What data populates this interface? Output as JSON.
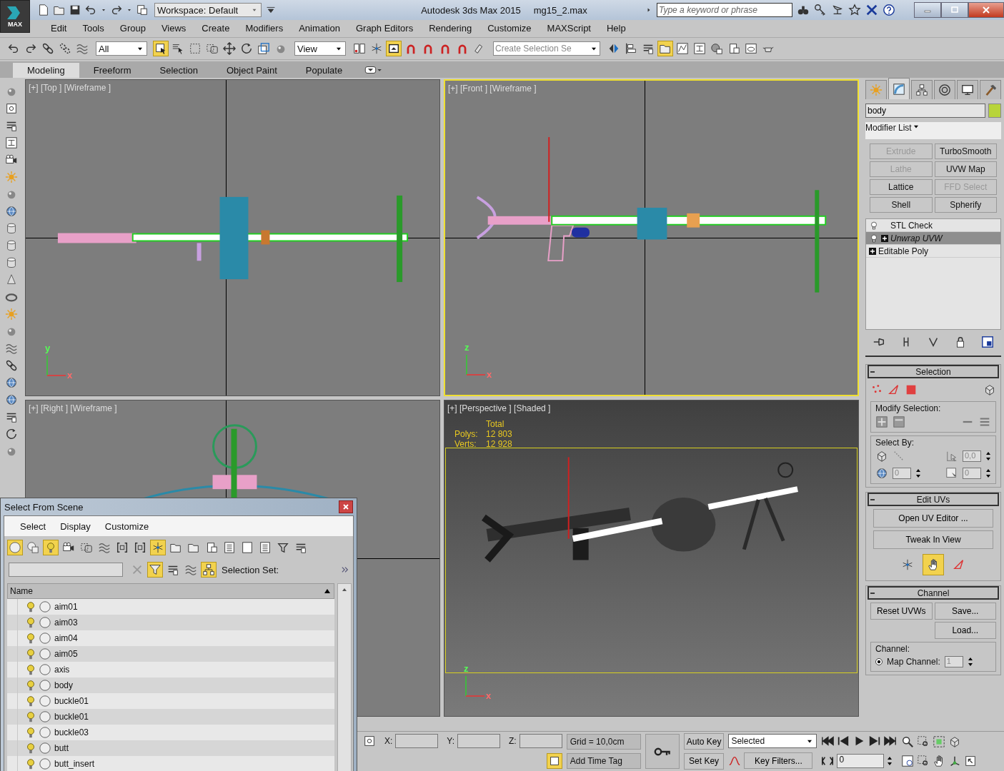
{
  "title_bar": {
    "app_label": "MAX",
    "workspace": "Workspace: Default",
    "title": "Autodesk 3ds Max  2015",
    "file": "mg15_2.max",
    "search": {
      "placeholder": "Type a keyword or phrase"
    }
  },
  "menu_bar": [
    "Edit",
    "Tools",
    "Group",
    "Views",
    "Create",
    "Modifiers",
    "Animation",
    "Graph Editors",
    "Rendering",
    "Customize",
    "MAXScript",
    "Help"
  ],
  "main_toolbar": {
    "left_buttons": [
      {
        "on": false
      },
      {
        "on": false
      },
      {
        "on": false
      },
      {
        "on": false
      },
      {
        "on": false
      }
    ],
    "selection_filter": "All",
    "select_buttons": [
      {
        "on": true
      },
      {
        "on": false
      },
      {
        "on": false
      },
      {
        "on": false
      },
      {
        "on": false
      },
      {
        "on": false
      },
      {
        "on": false
      },
      {
        "on": false
      }
    ],
    "reference_coordinate": "View",
    "snap_buttons": [
      {
        "on": false
      },
      {
        "on": false
      },
      {
        "on": true
      },
      {
        "on": false
      },
      {
        "on": false
      },
      {
        "on": false
      },
      {
        "on": false
      },
      {
        "on": false
      }
    ],
    "named_selection": {
      "placeholder": "Create Selection Se"
    },
    "scene_buttons": [
      {
        "on": false
      },
      {
        "on": false
      },
      {
        "on": false
      },
      {
        "on": true
      },
      {
        "on": false
      },
      {
        "on": false
      },
      {
        "on": false
      },
      {
        "on": false
      },
      {
        "on": false
      },
      {
        "on": false
      }
    ]
  },
  "ribbon_tabs": [
    {
      "label": "Modeling",
      "selected": true
    },
    {
      "label": "Freeform",
      "selected": false
    },
    {
      "label": "Selection",
      "selected": false
    },
    {
      "label": "Object Paint",
      "selected": false
    },
    {
      "label": "Populate",
      "selected": false
    }
  ],
  "viewports": [
    {
      "kind": "top",
      "label": "[+] [Top ] [Wireframe ]",
      "active": false,
      "axes": [
        "y",
        "x"
      ]
    },
    {
      "kind": "front",
      "label": "[+] [Front ] [Wireframe ]",
      "active": true,
      "axes": [
        "z",
        "x"
      ]
    },
    {
      "kind": "right",
      "label": "[+] [Right ] [Wireframe ]",
      "active": false
    },
    {
      "kind": "perspective",
      "label": "[+] [Perspective ] [Shaded ]",
      "active": false,
      "axes": [
        "z",
        "x"
      ],
      "stats": {
        "heading": "Total",
        "rows": [
          {
            "label": "Polys:",
            "value": "12 803"
          },
          {
            "label": "Verts:",
            "value": "12 928"
          }
        ]
      }
    }
  ],
  "command_panel": {
    "tabs": [
      {
        "selected": false
      },
      {
        "selected": true
      },
      {
        "selected": false
      },
      {
        "selected": false
      },
      {
        "selected": false
      },
      {
        "selected": false
      }
    ],
    "object_name": "body",
    "modifier_list": "Modifier List",
    "modifier_buttons": [
      {
        "label": "Extrude",
        "disabled": true
      },
      {
        "label": "TurboSmooth",
        "disabled": false
      },
      {
        "label": "Lathe",
        "disabled": true
      },
      {
        "label": "UVW Map",
        "disabled": false
      },
      {
        "label": "Lattice",
        "disabled": false
      },
      {
        "label": "FFD Select",
        "disabled": true
      },
      {
        "label": "Shell",
        "disabled": false
      },
      {
        "label": "Spherify",
        "disabled": false
      }
    ],
    "stack": [
      {
        "label": "STL Check",
        "kind": "modifier",
        "expandable": false,
        "selected": false
      },
      {
        "label": "Unwrap UVW",
        "kind": "modifier",
        "expandable": true,
        "selected": true
      },
      {
        "label": "Editable Poly",
        "kind": "base",
        "expandable": true,
        "selected": false
      }
    ],
    "selection_rollout": {
      "title": "Selection",
      "modify_label": "Modify Selection:",
      "select_by_label": "Select By:",
      "angle": "0,0",
      "spin_1": "0",
      "spin_2": "0"
    },
    "edit_uvs_rollout": {
      "title": "Edit UVs",
      "buttons": [
        "Open UV Editor ...",
        "Tweak In View"
      ],
      "tools": [
        {
          "selected": false
        },
        {
          "selected": true
        },
        {
          "selected": false
        }
      ]
    },
    "channel_rollout": {
      "title": "Channel",
      "buttons": [
        "Reset UVWs",
        "Save...",
        "Load..."
      ],
      "group_label": "Channel:",
      "map_channel": {
        "label": "Map Channel:",
        "selected": true,
        "value": "1"
      }
    }
  },
  "status_bar": {
    "x_label": "X:",
    "y_label": "Y:",
    "z_label": "Z:",
    "grid": "Grid = 10,0cm",
    "time_tag": "Add Time Tag",
    "auto_key": "Auto Key",
    "set_key": "Set Key",
    "key_mode": "Selected",
    "key_filters": "Key Filters...",
    "frame": "0"
  },
  "dialog": {
    "title": "Select From Scene",
    "menu": [
      "Select",
      "Display",
      "Customize"
    ],
    "toolbar": [
      {
        "on": true
      },
      {
        "on": false
      },
      {
        "on": true
      },
      {
        "on": false
      },
      {
        "on": false
      },
      {
        "on": false
      },
      {
        "on": false
      },
      {
        "on": false
      },
      {
        "on": true
      },
      {
        "on": false
      },
      {
        "on": false
      },
      {
        "on": false
      },
      {
        "on": false
      },
      {
        "on": false
      },
      {
        "on": false
      },
      {
        "on": false
      },
      {
        "on": false
      }
    ],
    "filter_buttons": [
      {
        "on": false
      },
      {
        "on": true
      },
      {
        "on": false
      },
      {
        "on": false
      },
      {
        "on": true
      }
    ],
    "selection_set_label": "Selection Set:",
    "column": "Name",
    "rows": [
      "aim01",
      "aim03",
      "aim04",
      "aim05",
      "axis",
      "body",
      "buckle01",
      "buckle01",
      "buckle03",
      "butt",
      "butt_insert"
    ]
  }
}
